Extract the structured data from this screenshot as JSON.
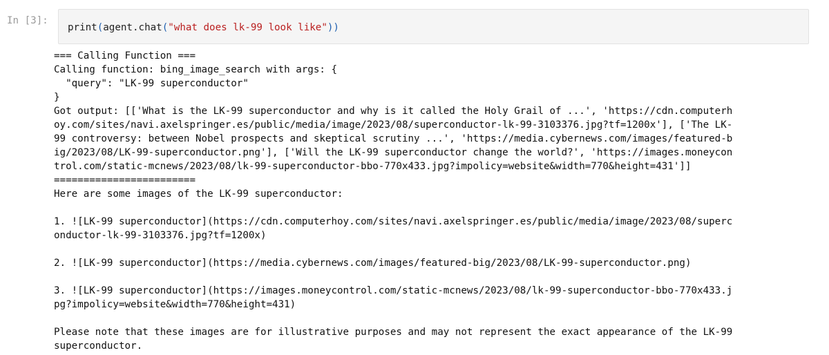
{
  "cell": {
    "prompt": "In [3]:",
    "input": {
      "func": "print",
      "open_paren": "(",
      "obj": "agent",
      "dot": ".",
      "method": "chat",
      "inner_open": "(",
      "arg": "\"what does lk-99 look like\"",
      "close_parens": "))"
    }
  },
  "output": {
    "lines": [
      "=== Calling Function ===",
      "Calling function: bing_image_search with args: {",
      "  \"query\": \"LK-99 superconductor\"",
      "}",
      "Got output: [['What is the LK-99 superconductor and why is it called the Holy Grail of ...', 'https://cdn.computerh",
      "oy.com/sites/navi.axelspringer.es/public/media/image/2023/08/superconductor-lk-99-3103376.jpg?tf=1200x'], ['The LK-",
      "99 controversy: between Nobel prospects and skeptical scrutiny ...', 'https://media.cybernews.com/images/featured-b",
      "ig/2023/08/LK-99-superconductor.png'], ['Will the LK-99 superconductor change the world?', 'https://images.moneycon",
      "trol.com/static-mcnews/2023/08/lk-99-superconductor-bbo-770x433.jpg?impolicy=website&width=770&height=431']]",
      "========================",
      "Here are some images of the LK-99 superconductor:",
      "",
      "1. ![LK-99 superconductor](https://cdn.computerhoy.com/sites/navi.axelspringer.es/public/media/image/2023/08/superc",
      "onductor-lk-99-3103376.jpg?tf=1200x)",
      "",
      "2. ![LK-99 superconductor](https://media.cybernews.com/images/featured-big/2023/08/LK-99-superconductor.png)",
      "",
      "3. ![LK-99 superconductor](https://images.moneycontrol.com/static-mcnews/2023/08/lk-99-superconductor-bbo-770x433.j",
      "pg?impolicy=website&width=770&height=431)",
      "",
      "Please note that these images are for illustrative purposes and may not represent the exact appearance of the LK-99",
      "superconductor."
    ]
  }
}
